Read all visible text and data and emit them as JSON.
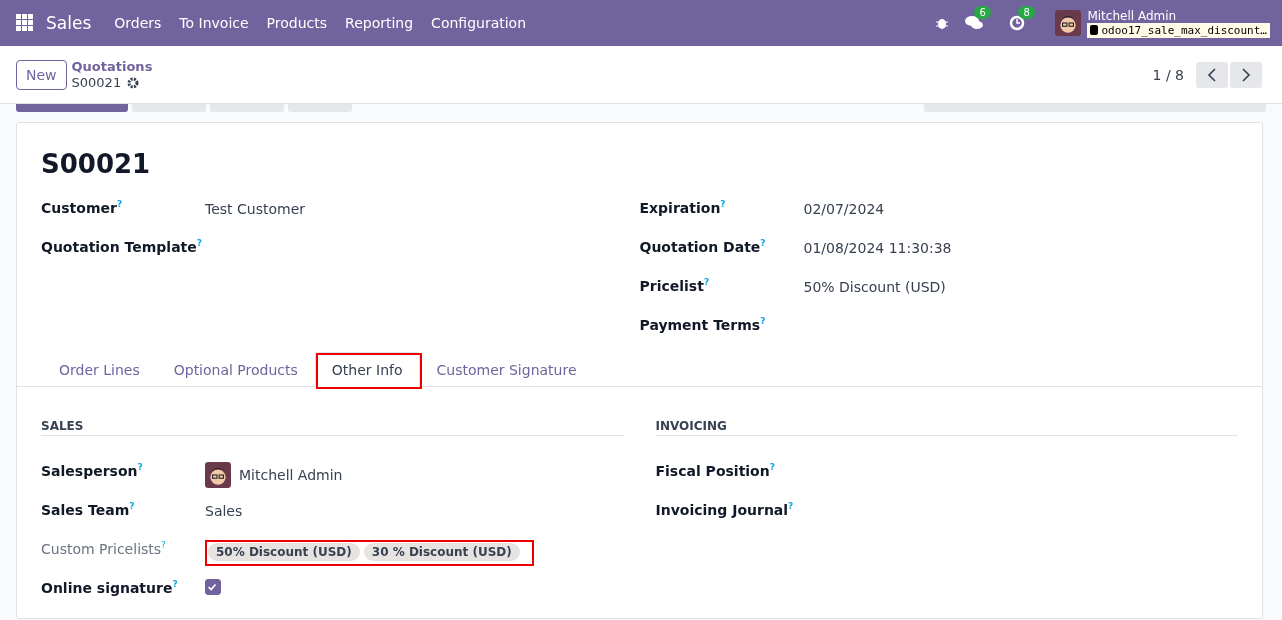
{
  "navbar": {
    "app": "Sales",
    "menu": [
      "Orders",
      "To Invoice",
      "Products",
      "Reporting",
      "Configuration"
    ],
    "messages_count": "6",
    "activities_count": "8",
    "user": "Mitchell Admin",
    "database": "odoo17_sale_max_discount…"
  },
  "control_panel": {
    "new_button": "New",
    "breadcrumb": "Quotations",
    "record": "S00021",
    "pager": "1 / 8"
  },
  "record": {
    "name": "S00021",
    "left_fields": [
      {
        "label": "Customer$^{?}$",
        "value": "Test Customer"
      },
      {
        "label": "Quotation Template$^{?}$"
      }
    ],
    "right_fields": [
      {
        "label": "Expiration$^{?}$",
        "value": "02/07/2024"
      },
      {
        "label": "Quotation Date$^{?}$",
        "value": "01/08/2024 11:30:38"
      },
      {
        "label": "Pricelist$^{?}$",
        "value": "50% Discount (USD)"
      },
      {
        "label": "Payment Terms$^{?}$"
      }
    ],
    "tabs": [
      {
        "label": "Order Lines",
        "selected": false,
        "highlighted": false
      },
      {
        "label": "Optional Products",
        "selected": false,
        "highlighted": false
      },
      {
        "label": "Other Info",
        "selected": true,
        "highlighted": true
      },
      {
        "label": "Customer Signature",
        "selected": false,
        "highlighted": false
      }
    ],
    "sales": {
      "title": "SALES",
      "fields": [
        {
          "kind": "user",
          "label": "Salesperson$^{?}$",
          "muted": false,
          "value": "Mitchell Admin"
        },
        {
          "kind": "text",
          "label": "Sales Team$^{?}$",
          "muted": false,
          "value": "Sales"
        },
        {
          "kind": "tags",
          "label": "Custom Pricelists$^{?}$",
          "muted": true,
          "highlighted": true,
          "tags": [
            "50% Discount (USD)",
            "30 % Discount (USD)"
          ]
        },
        {
          "kind": "checkbox",
          "label": "Online signature$^{?}$",
          "muted": false,
          "checked": true
        }
      ]
    },
    "invoicing": {
      "title": "INVOICING",
      "fields": [
        {
          "label": "Fiscal Position$^{?}$"
        },
        {
          "label": "Invoicing Journal$^{?}$"
        }
      ]
    }
  }
}
